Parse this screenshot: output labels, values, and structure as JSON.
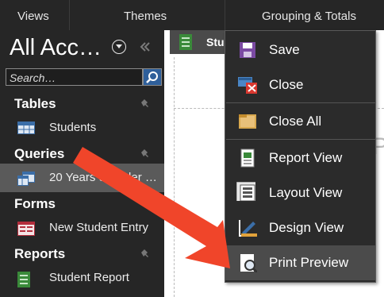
{
  "ribbon": {
    "groups": [
      "Views",
      "Themes",
      "Grouping & Totals"
    ]
  },
  "nav": {
    "title": "All Acc…",
    "search_placeholder": "Search…",
    "categories": [
      {
        "label": "Tables",
        "items": [
          {
            "label": "Students",
            "icon": "table-icon"
          }
        ]
      },
      {
        "label": "Queries",
        "items": [
          {
            "label": "20 Years or Older …",
            "icon": "query-icon",
            "selected": true
          }
        ]
      },
      {
        "label": "Forms",
        "items": [
          {
            "label": "New Student Entry",
            "icon": "form-icon"
          }
        ]
      },
      {
        "label": "Reports",
        "items": [
          {
            "label": "Student Report",
            "icon": "report-icon"
          }
        ]
      }
    ]
  },
  "doc_tab": {
    "label": "Stu"
  },
  "context_menu": {
    "items": [
      {
        "label": "Save",
        "icon": "save-icon"
      },
      {
        "label": "Close",
        "icon": "close-icon"
      },
      {
        "label": "Close All",
        "icon": "folder-icon"
      },
      {
        "label": "Report View",
        "icon": "report-view-icon"
      },
      {
        "label": "Layout View",
        "icon": "layout-view-icon"
      },
      {
        "label": "Design View",
        "icon": "design-view-icon"
      },
      {
        "label": "Print Preview",
        "icon": "print-preview-icon",
        "highlighted": true
      }
    ]
  },
  "colors": {
    "annotation_arrow": "#f0452a",
    "accent": "#2f5f9a"
  }
}
